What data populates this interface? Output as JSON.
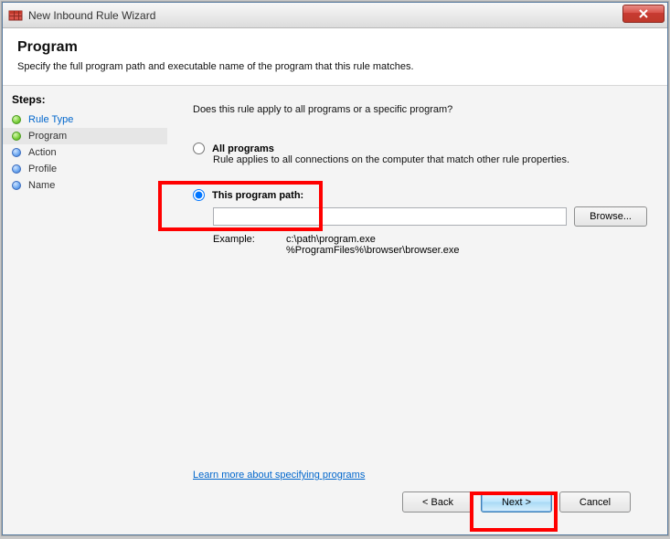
{
  "window": {
    "title": "New Inbound Rule Wizard"
  },
  "header": {
    "title": "Program",
    "subtitle": "Specify the full program path and executable name of the program that this rule matches."
  },
  "sidebar": {
    "steps_label": "Steps:",
    "steps": [
      {
        "label": "Rule Type",
        "status": "done",
        "link": true
      },
      {
        "label": "Program",
        "status": "done",
        "link": false,
        "active": true
      },
      {
        "label": "Action",
        "status": "pending",
        "link": false
      },
      {
        "label": "Profile",
        "status": "pending",
        "link": false
      },
      {
        "label": "Name",
        "status": "pending",
        "link": false
      }
    ]
  },
  "content": {
    "question": "Does this rule apply to all programs or a specific program?",
    "option_all": {
      "label": "All programs",
      "desc": "Rule applies to all connections on the computer that match other rule properties."
    },
    "option_path": {
      "label": "This program path:",
      "value": "",
      "browse": "Browse...",
      "example_label": "Example:",
      "example_value": "c:\\path\\program.exe\n%ProgramFiles%\\browser\\browser.exe"
    },
    "learn_more": "Learn more about specifying programs"
  },
  "footer": {
    "back": "< Back",
    "next": "Next >",
    "cancel": "Cancel"
  }
}
